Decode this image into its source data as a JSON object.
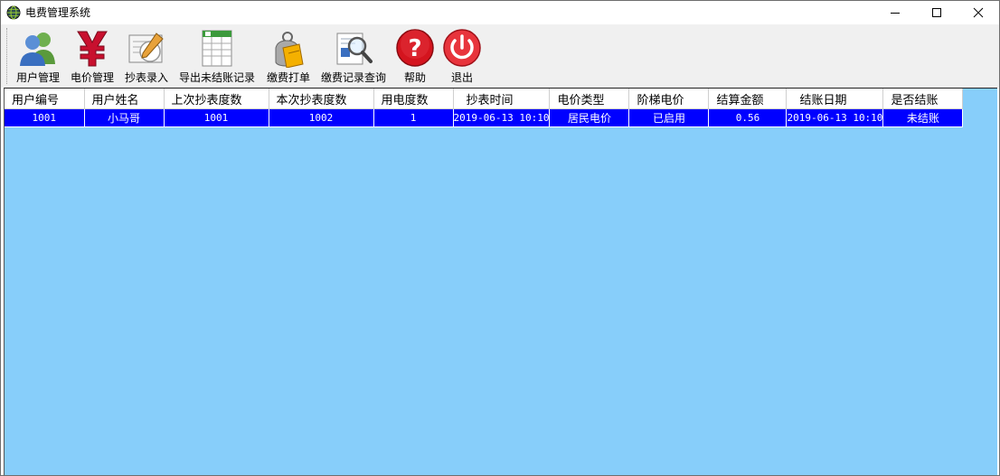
{
  "window": {
    "title": "电费管理系统"
  },
  "toolbar": {
    "items": [
      {
        "label": "用户管理",
        "icon": "users-icon"
      },
      {
        "label": "电价管理",
        "icon": "yen-icon"
      },
      {
        "label": "抄表录入",
        "icon": "meter-entry-icon"
      },
      {
        "label": "导出未结账记录",
        "icon": "spreadsheet-export-icon"
      },
      {
        "label": "缴费打单",
        "icon": "payment-bag-icon"
      },
      {
        "label": "缴费记录查询",
        "icon": "search-record-icon"
      },
      {
        "label": "帮助",
        "icon": "help-icon"
      },
      {
        "label": "退出",
        "icon": "power-icon"
      }
    ]
  },
  "grid": {
    "columns": [
      "用户编号",
      "用户姓名",
      "上次抄表度数",
      "本次抄表度数",
      "用电度数",
      "抄表时间",
      "电价类型",
      "阶梯电价",
      "结算金额",
      "结账日期",
      "是否结账"
    ],
    "rows": [
      [
        "1001",
        "小马哥",
        "1001",
        "1002",
        "1",
        "2019-06-13 10:10",
        "居民电价",
        "已启用",
        "0.56",
        "2019-06-13 10:10",
        "未结账"
      ]
    ]
  },
  "colors": {
    "grid_background": "#87cefa",
    "selected_row": "#0000ff",
    "toolbar_background": "#f0f0f0"
  }
}
